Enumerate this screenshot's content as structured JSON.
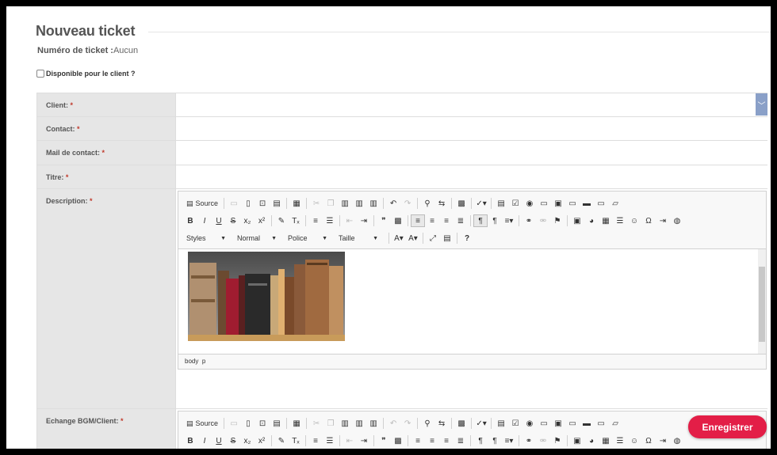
{
  "page": {
    "title": "Nouveau ticket"
  },
  "ticket": {
    "label": "Numéro de ticket :",
    "value": "Aucun"
  },
  "dispo": {
    "label": "Disponible pour le client ?"
  },
  "required_mark": "*",
  "fields": {
    "client": "Client:",
    "contact": "Contact:",
    "mail": "Mail de contact:",
    "titre": "Titre:",
    "description": "Description:",
    "echange": "Echange BGM/Client:"
  },
  "toolbar": {
    "source": "Source",
    "styles": "Styles",
    "format": "Normal",
    "font": "Police",
    "size": "Taille"
  },
  "editor": {
    "path_body": "body",
    "path_p": "p"
  },
  "actions": {
    "save": "Enregistrer"
  },
  "colors": {
    "accent": "#e31e47",
    "dropdown": "#8aa0c8"
  }
}
